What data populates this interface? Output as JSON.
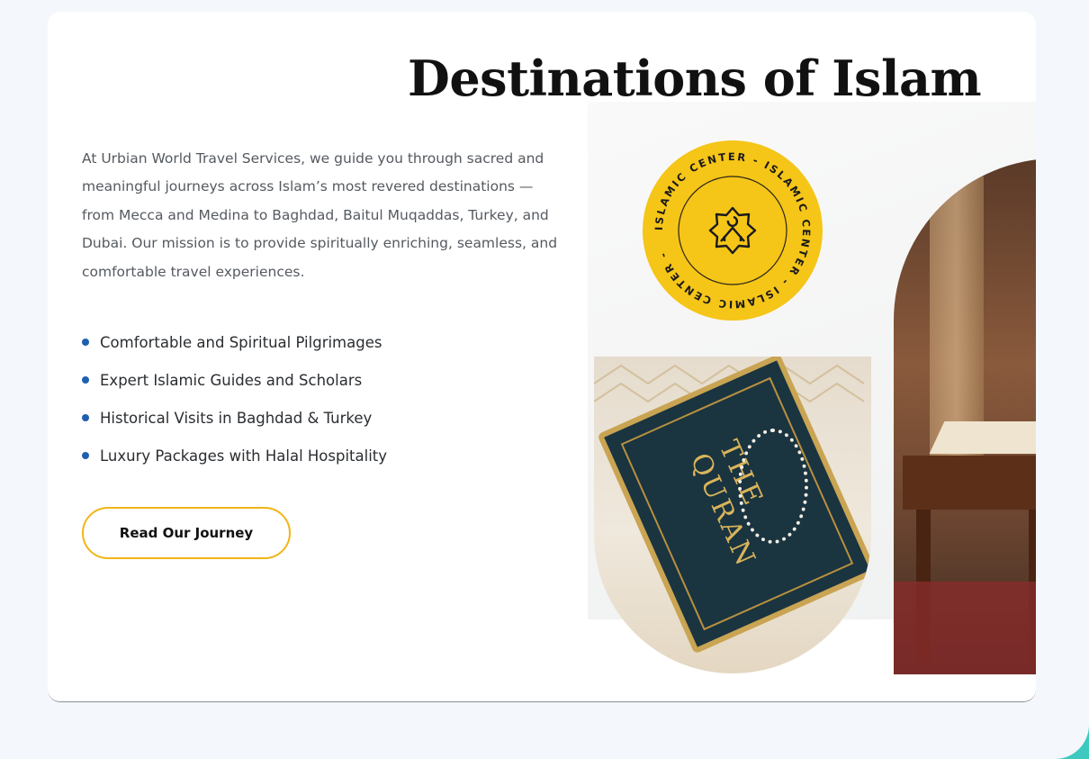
{
  "section": {
    "title": "Destinations of Islam",
    "intro": "At Urbian World Travel Services, we guide you through sacred and meaningful journeys across Islam’s most revered destinations — from Mecca and Medina to Baghdad, Baitul Muqaddas, Turkey, and Dubai. Our mission is to provide spiritually enriching, seamless, and comfortable travel experiences.",
    "features": [
      "Comfortable and Spiritual Pilgrimages",
      "Expert Islamic Guides and Scholars",
      "Historical Visits in Baghdad & Turkey",
      "Luxury Packages with Halal Hospitality"
    ],
    "cta_label": "Read Our Journey"
  },
  "badge": {
    "ring_text": "ISLAMIC CENTER - ISLAMIC CENTER - ISLAMIC CENTER - ",
    "icon": "mosque-icon"
  },
  "images": {
    "left_photo_icon": "quran-photo",
    "right_photo_icon": "mosque-interior-photo",
    "book_cover_text": "THE QURAN"
  },
  "colors": {
    "accent_yellow": "#f5c518",
    "bullet_blue": "#1f5fb0",
    "button_border": "#f2b515",
    "frame_teal": "#3cc9bf"
  }
}
